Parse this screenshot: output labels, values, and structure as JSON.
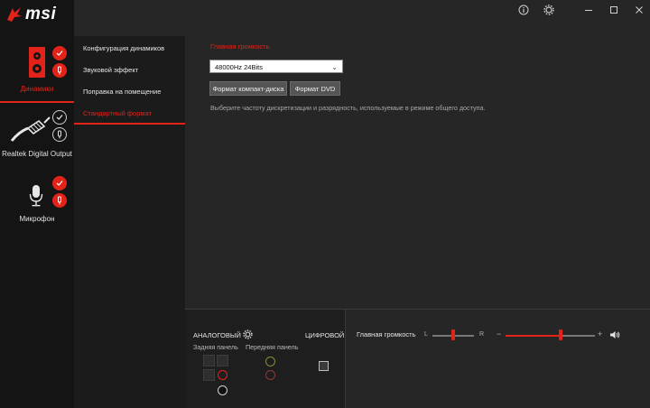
{
  "brand": {
    "logo_text": "msi"
  },
  "devices": [
    {
      "label": "Динамики",
      "active": true
    },
    {
      "label": "Realtek Digital Output",
      "active": false
    },
    {
      "label": "Микрофон",
      "active": false
    }
  ],
  "menu": [
    {
      "label": "Конфигурация динамиков",
      "active": false
    },
    {
      "label": "Звуковой эффект",
      "active": false
    },
    {
      "label": "Поправка на помещение",
      "active": false
    },
    {
      "label": "Стандартный формат",
      "active": true
    }
  ],
  "content": {
    "section_title": "Главная громкость",
    "sample_rate_value": "48000Hz 24Bits",
    "cd_format_button": "Формат компакт-диска",
    "dvd_format_button": "Формат DVD",
    "description": "Выберите частоту дискретизации и разрядность, используемые в режиме общего доступа."
  },
  "connectors": {
    "analog_label": "АНАЛОГОВЫЙ",
    "digital_label": "ЦИФРОВОЙ",
    "rear_panel": "Задняя панель",
    "front_panel": "Передняя панель"
  },
  "volume": {
    "label": "Главная громкость",
    "left": "L",
    "right": "R",
    "minus": "−",
    "plus": "+",
    "balance": 0.5,
    "level": 0.62
  },
  "colors": {
    "accent": "#e2231a",
    "bg": "#262626",
    "sidebar": "#141414"
  }
}
